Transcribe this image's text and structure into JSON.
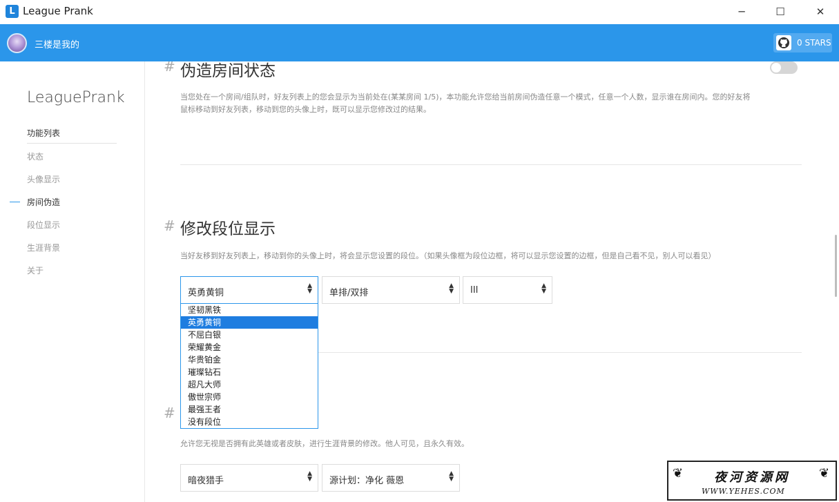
{
  "window": {
    "title": "League Prank",
    "app_icon": "L",
    "controls": {
      "minimize": "─",
      "maximize": "☐",
      "close": "✕"
    }
  },
  "header": {
    "username": "三楼是我的",
    "stars_label": "0 STARS",
    "accent": "#2b96ea"
  },
  "sidebar": {
    "logo": "LeaguePrank",
    "heading": "功能列表",
    "items": [
      {
        "label": "状态",
        "active": false
      },
      {
        "label": "头像显示",
        "active": false
      },
      {
        "label": "房间伪造",
        "active": true
      },
      {
        "label": "段位显示",
        "active": false
      },
      {
        "label": "生涯背景",
        "active": false
      },
      {
        "label": "关于",
        "active": false
      }
    ]
  },
  "sections": {
    "room": {
      "hash": "#",
      "title": "伪造房间状态",
      "toggle_on": false,
      "desc_line1": "当您处在一个房间/组队时，好友列表上的您会显示为当前处在(某某房间 1/5)，本功能允许您给当前房间伪造任意一个模式，任意一个人数，显示谁在房间内。您的好友将",
      "desc_line2": "鼠标移动到好友列表，移动到您的头像上时，既可以显示您修改过的结果。"
    },
    "rank": {
      "hash": "#",
      "title": "修改段位显示",
      "desc": "当好友移到好友列表上，移动到你的头像上时，将会显示您设置的段位。（如果头像框为段位边框，将可以显示您设置的边框，但是自己看不见，别人可以看见）",
      "tier_select": "英勇黄铜",
      "queue_select": "单排/双排",
      "division_select": "III",
      "dropdown_options": [
        "坚韧黑铁",
        "英勇黄铜",
        "不屈白银",
        "荣耀黄金",
        "华贵铂金",
        "璀璨钻石",
        "超凡大师",
        "傲世宗师",
        "最强王者",
        "没有段位"
      ],
      "selected_index": 1
    },
    "career": {
      "hash": "#",
      "desc": "允许您无视是否拥有此英雄或者皮肤，进行生涯背景的修改。他人可见，且永久有效。",
      "champion_select": "暗夜猎手",
      "skin_select": "源计划：净化 薇恩"
    }
  },
  "watermark": {
    "title": "夜河资源网",
    "url": "WWW.YEHES.COM"
  }
}
